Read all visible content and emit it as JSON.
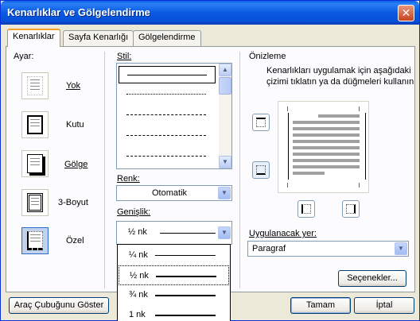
{
  "window": {
    "title": "Kenarlıklar ve Gölgelendirme",
    "close_glyph": "✕"
  },
  "tabs": [
    {
      "label": "Kenarlıklar"
    },
    {
      "label": "Sayfa Kenarlığı"
    },
    {
      "label": "Gölgelendirme"
    }
  ],
  "setting": {
    "header": "Ayar:",
    "options": [
      {
        "label": "Yok"
      },
      {
        "label": "Kutu"
      },
      {
        "label": "Gölge"
      },
      {
        "label": "3-Boyut"
      },
      {
        "label": "Özel"
      }
    ]
  },
  "style": {
    "label": "Stil:"
  },
  "color": {
    "label": "Renk:",
    "value": "Otomatik"
  },
  "width": {
    "label": "Genişlik:",
    "value": "½ nk",
    "options": [
      {
        "label": "¼ nk"
      },
      {
        "label": "½ nk"
      },
      {
        "label": "¾ nk"
      },
      {
        "label": "1 nk"
      }
    ]
  },
  "preview": {
    "header": "Önizleme",
    "instructions_line1": "Kenarlıkları uygulamak için aşağıdaki",
    "instructions_line2": "çizimi tıklatın ya da düğmeleri kullanın"
  },
  "apply_to": {
    "label": "Uygulanacak yer:",
    "value": "Paragraf"
  },
  "buttons": {
    "options": "Seçenekler...",
    "toolbar": "Araç Çubuğunu Göster",
    "ok": "Tamam",
    "cancel": "İptal"
  },
  "colors": {
    "title_bar": "#0a5ae0",
    "dialog_bg": "#ece9d8",
    "panel_bg": "#fcfcfe",
    "accent": "#316ac5"
  }
}
